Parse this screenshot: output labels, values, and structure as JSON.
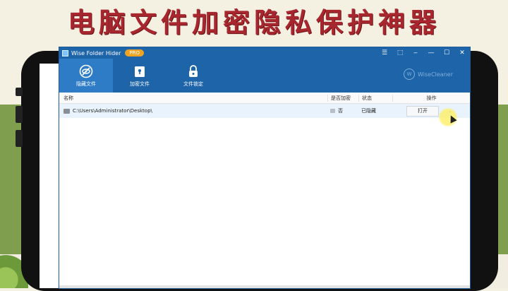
{
  "banner": {
    "text": "电脑文件加密隐私保护神器"
  },
  "window": {
    "title": "Wise Folder Hider",
    "badge": "PRO",
    "controls": [
      "☰",
      "⬚",
      "‒",
      "—",
      "☐",
      "✕"
    ]
  },
  "toolbar": {
    "items": [
      {
        "label": "隐藏文件",
        "icon": "eye-off-icon",
        "active": true
      },
      {
        "label": "加密文件",
        "icon": "folder-lock-icon",
        "active": false
      },
      {
        "label": "文件锁定",
        "icon": "lock-icon",
        "active": false
      }
    ],
    "brand": "WiseCleaner",
    "brand_logo": "W"
  },
  "table": {
    "headers": {
      "name": "名称",
      "encrypted": "是否加密",
      "status": "状态",
      "action": "操作"
    },
    "rows": [
      {
        "path": "C:\\Users\\Administrator\\Desktop\\",
        "encrypted": "否",
        "status": "已隐藏",
        "action_label": "打开",
        "dropdown": "⌄"
      }
    ]
  },
  "colors": {
    "accent": "#1e64a8",
    "badge": "#f0a323",
    "banner": "#a8262e",
    "row_highlight": "#e9f3fd"
  }
}
